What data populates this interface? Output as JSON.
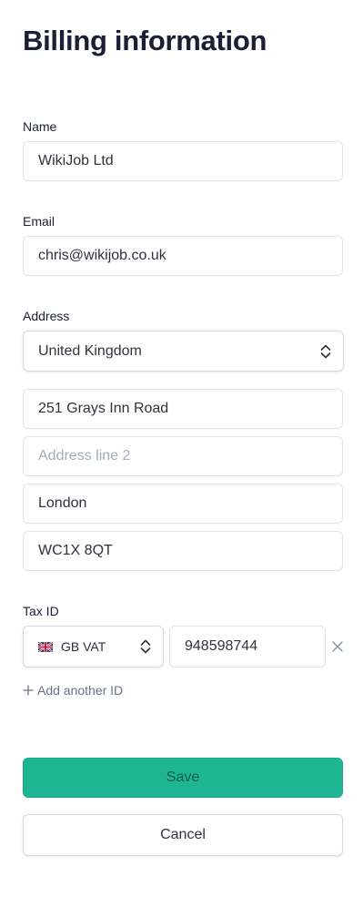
{
  "page_title": "Billing information",
  "name": {
    "label": "Name",
    "value": "WikiJob Ltd"
  },
  "email": {
    "label": "Email",
    "value": "chris@wikijob.co.uk"
  },
  "address": {
    "label": "Address",
    "country": "United Kingdom",
    "line1": "251 Grays Inn Road",
    "line2_placeholder": "Address line 2",
    "city": "London",
    "postcode": "WC1X 8QT"
  },
  "tax": {
    "label": "Tax ID",
    "type": "GB VAT",
    "value": "948598744",
    "add_label": "Add another ID"
  },
  "buttons": {
    "save": "Save",
    "cancel": "Cancel"
  },
  "colors": {
    "accent": "#1db592",
    "text": "#1a1f36",
    "muted": "#697386",
    "placeholder": "#a3acb9"
  },
  "icons": {
    "select_chevron": "up-down-chevron-icon",
    "flag": "uk-flag-icon",
    "remove": "close-icon",
    "add": "plus-icon"
  }
}
